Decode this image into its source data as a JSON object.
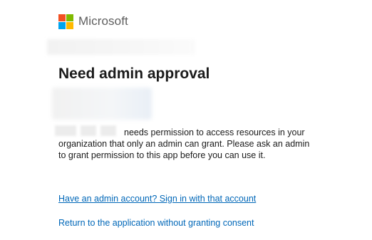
{
  "brand": {
    "name": "Microsoft",
    "logo_colors": [
      "#f25022",
      "#7fba00",
      "#00a4ef",
      "#ffb900"
    ]
  },
  "dialog": {
    "title": "Need admin approval",
    "description": "needs permission to access resources in your organization that only an admin can grant. Please ask an admin to grant permission to this app before you can use it.",
    "admin_signin_link": "Have an admin account? Sign in with that account",
    "return_link": "Return to the application without granting consent"
  },
  "colors": {
    "link": "#0067b8",
    "text": "#1b1b1b",
    "brand_text": "#5e5e5e"
  }
}
